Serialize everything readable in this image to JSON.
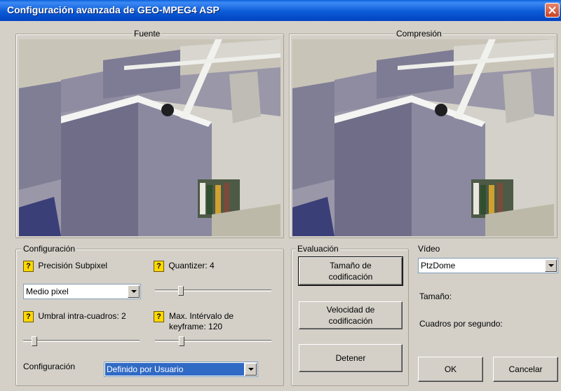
{
  "window": {
    "title": "Configuración avanzada de GEO-MPEG4 ASP"
  },
  "panels": {
    "source_label": "Fuente",
    "compressed_label": "Compresión"
  },
  "config": {
    "legend": "Configuración",
    "subpixel_label": "Precisión Subpixel",
    "subpixel_value": "Medio pixel",
    "quantizer_label": "Quantizer: 4",
    "quantizer_value": 4,
    "intra_label": "Umbral intra-cuadros: 2",
    "intra_value": 2,
    "keyframe_label": "Max. Intérvalo de\nkeyframe: 120",
    "keyframe_value": 120,
    "preset_label": "Configuración",
    "preset_value": "Definido por Usuario",
    "help_glyph": "?"
  },
  "evaluation": {
    "legend": "Evaluación",
    "size_button": "Tamaño de\ncodificación",
    "speed_button": "Velocidad de\ncodificación",
    "stop_button": "Detener"
  },
  "video": {
    "label": "Vídeo",
    "source_value": "PtzDome",
    "size_label": "Tamaño:",
    "fps_label": "Cuadros por segundo:"
  },
  "buttons": {
    "ok": "OK",
    "cancel": "Cancelar"
  },
  "colors": {
    "titlebar": "#0b5bd6",
    "help_icon": "#ffd800",
    "selection": "#316ac5"
  }
}
